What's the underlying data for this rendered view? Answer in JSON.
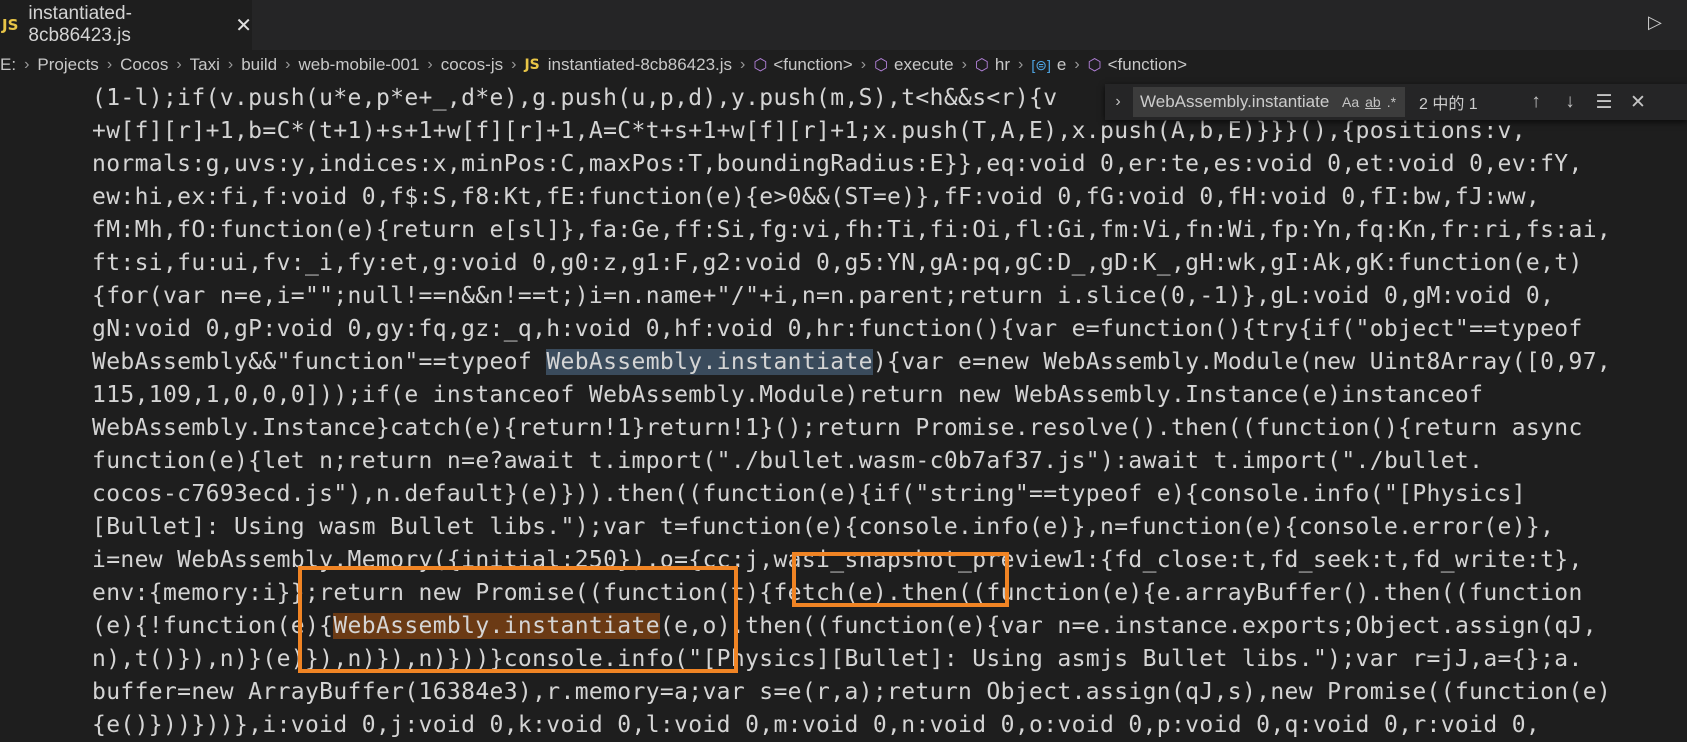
{
  "tab": {
    "icon_label": "JS",
    "filename": "instantiated-8cb86423.js",
    "close_glyph": "✕"
  },
  "toolbar": {
    "run_glyph": "▷"
  },
  "breadcrumb": {
    "items": [
      "E:",
      "Projects",
      "Cocos",
      "Taxi",
      "build",
      "web-mobile-001",
      "cocos-js"
    ],
    "file_icon_label": "JS",
    "file": "instantiated-8cb86423.js",
    "symbols": [
      "<function>",
      "execute",
      "hr",
      "e",
      "<function>"
    ]
  },
  "find": {
    "query": "WebAssembly.instantiate",
    "opt_case": "Aa",
    "opt_word": "ab",
    "opt_regex": ".*",
    "count": "2 中的 1"
  },
  "code": {
    "l1": "(1-l);if(v.push(u*e,p*e+_,d*e),g.push(u,p,d),y.push(m,S),t<h&&s<r){v",
    "l2": "+w[f][r]+1,b=C*(t+1)+s+1+w[f][r]+1,A=C*t+s+1+w[f][r]+1;x.push(T,A,E),x.push(A,b,E)}}}(),{positions:v,",
    "l3": "normals:g,uvs:y,indices:x,minPos:C,maxPos:T,boundingRadius:E}},eq:void 0,er:te,es:void 0,et:void 0,ev:fY,",
    "l4": "ew:hi,ex:fi,f:void 0,f$:S,f8:Kt,fE:function(e){e>0&&(ST=e)},fF:void 0,fG:void 0,fH:void 0,fI:bw,fJ:ww,",
    "l5": "fM:Mh,fO:function(e){return e[sl]},fa:Ge,ff:Si,fg:vi,fh:Ti,fi:Oi,fl:Gi,fm:Vi,fn:Wi,fp:Yn,fq:Kn,fr:ri,fs:ai,",
    "l6": "ft:si,fu:ui,fv:_i,fy:et,g:void 0,g0:z,g1:F,g2:void 0,g5:YN,gA:pq,gC:D_,gD:K_,gH:wk,gI:Ak,gK:function(e,t)",
    "l7": "{for(var n=e,i=\"\";null!==n&&n!==t;)i=n.name+\"/\"+i,n=n.parent;return i.slice(0,-1)},gL:void 0,gM:void 0,",
    "l8": "gN:void 0,gP:void 0,gy:fq,gz:_q,h:void 0,hf:void 0,hr:function(){var e=function(){try{if(\"object\"==typeof",
    "l9a": "WebAssembly&&\"function\"==typeof ",
    "l9b": "WebAssembly.instantiate",
    "l9c": "){var e=new WebAssembly.Module(new Uint8Array([0,97,",
    "l10": "115,109,1,0,0,0]));if(e instanceof WebAssembly.Module)return new WebAssembly.Instance(e)instanceof",
    "l11": "WebAssembly.Instance}catch(e){return!1}return!1}();return Promise.resolve().then((function(){return async",
    "l12": "function(e){let n;return n=e?await t.import(\"./bullet.wasm-c0b7af37.js\"):await t.import(\"./bullet.",
    "l13": "cocos-c7693ecd.js\"),n.default}(e)})).then((function(e){if(\"string\"==typeof e){console.info(\"[Physics]",
    "l14": "[Bullet]: Using wasm Bullet libs.\");var t=function(e){console.info(e)},n=function(e){console.error(e)},",
    "l15": "i=new WebAssembly.Memory({initial:250}),o={cc:j,wasi_snapshot_preview1:{fd_close:t,fd_seek:t,fd_write:t},",
    "l16": "env:{memory:i}};return new Promise((function(t){fetch(e).then((function(e){e.arrayBuffer().then((function",
    "l17a": "(e){!function(e){",
    "l17b": "WebAssembly.instantiate",
    "l17c": "(e,o).then((function(e){var n=e.instance.exports;Object.assign(qJ,",
    "l18": "n),t()}),n)}(e)}),n)}),n)}))}console.info(\"[Physics][Bullet]: Using asmjs Bullet libs.\");var r=jJ,a={};a.",
    "l19": "buffer=new ArrayBuffer(16384e3),r.memory=a;var s=e(r,a);return Object.assign(qJ,s),new Promise((function(e)",
    "l20": "{e()}))}))},i:void 0,j:void 0,k:void 0,l:void 0,m:void 0,n:void 0,o:void 0,p:void 0,q:void 0,r:void 0,"
  }
}
